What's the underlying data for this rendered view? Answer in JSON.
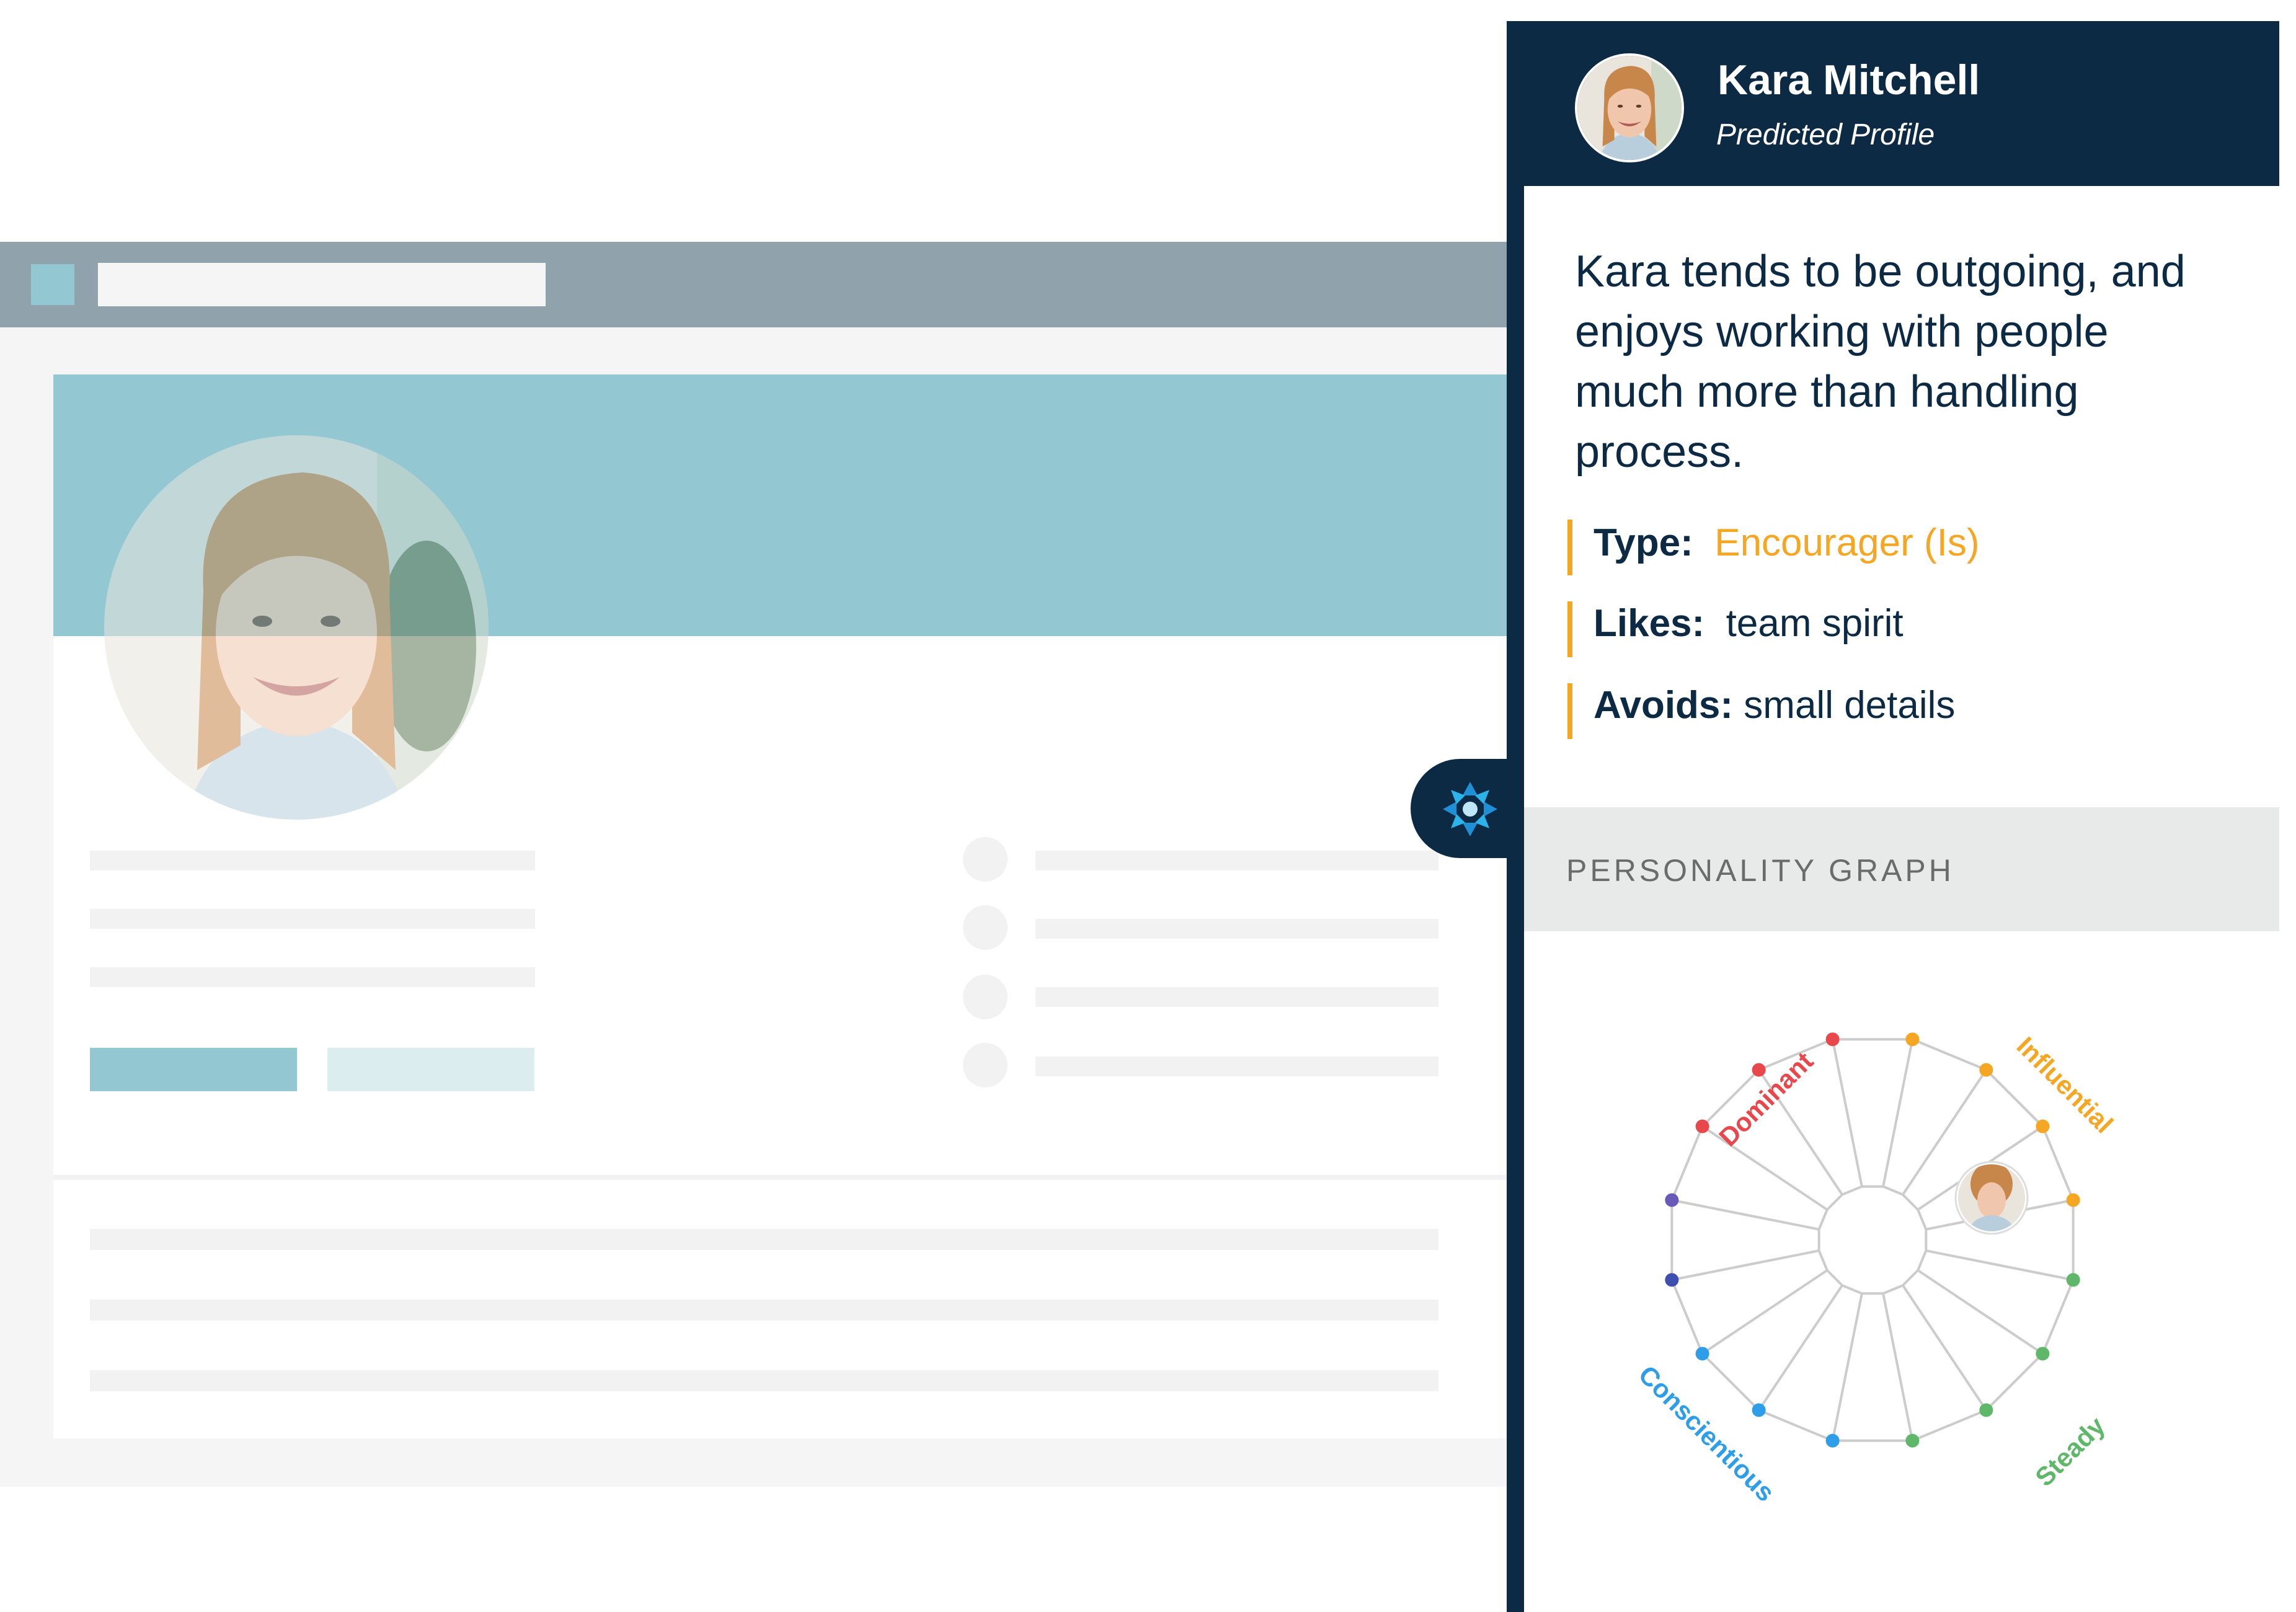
{
  "profile": {
    "name": "Kara Mitchell",
    "subtitle": "Predicted Profile",
    "summary": "Kara tends to be outgoing, and enjoys working with people much more than handling process."
  },
  "traits": [
    {
      "label": "Type:",
      "value": "Encourager (Is)"
    },
    {
      "label": "Likes:",
      "value": "team spirit"
    },
    {
      "label": "Avoids:",
      "value": "small details"
    }
  ],
  "graph": {
    "title": "PERSONALITY GRAPH",
    "quadrants": {
      "dominant": "Dominant",
      "influential": "Influential",
      "steady": "Steady",
      "conscientious": "Conscientious"
    }
  },
  "colors": {
    "navy": "#0d2a44",
    "accent": "#f5a623",
    "teal": "#93c8d2",
    "dominant": "#e8474c",
    "influential": "#f5a623",
    "steady": "#5fb769",
    "conscientious": "#2f9ee8"
  },
  "icons": {
    "connector": "crystal-logo-icon"
  }
}
